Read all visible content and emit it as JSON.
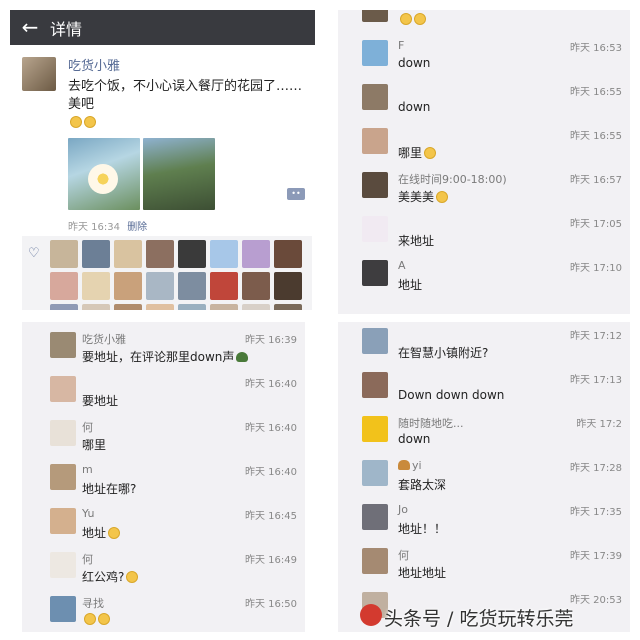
{
  "header": {
    "back_icon": "arrow-left-icon",
    "title": "详情"
  },
  "post": {
    "author": "吃货小雅",
    "text": "去吃个饭，不小心误入餐厅的花园了……美吧",
    "time": "昨天 16:34",
    "delete_label": "删除"
  },
  "comments_left": [
    {
      "name": "吃货小雅",
      "time": "昨天 16:39",
      "text": "要地址，在评论那里down声",
      "icon": "turtle",
      "avatar": "#9a8a73"
    },
    {
      "name": "",
      "time": "昨天 16:40",
      "text": "要地址",
      "avatar": "#d7b7a3"
    },
    {
      "name": "何",
      "time": "昨天 16:40",
      "text": "哪里",
      "avatar": "#e8e1d8"
    },
    {
      "name": "m",
      "time": "昨天 16:40",
      "text": "地址在哪?",
      "avatar": "#b59a7b"
    },
    {
      "name": "Yu",
      "time": "昨天 16:45",
      "text": "地址",
      "icon": "emoji",
      "avatar": "#d4b08e"
    },
    {
      "name": "何",
      "time": "昨天 16:49",
      "text": "红公鸡?",
      "icon": "emoji",
      "avatar": "#ede8e2"
    },
    {
      "name": "寻找",
      "time": "昨天 16:50",
      "text": "",
      "icon": "emoji2",
      "avatar": "#6d8fb0"
    }
  ],
  "comments_right_top": [
    {
      "name": "",
      "time": "",
      "text": "",
      "icon": "emoji2",
      "avatar": "#6b5b4a"
    },
    {
      "name": "F",
      "time": "昨天 16:53",
      "text": "down",
      "avatar": "#7eb0d8"
    },
    {
      "name": "",
      "time": "昨天 16:55",
      "text": "down",
      "avatar": "#8d7a66"
    },
    {
      "name": "",
      "time": "昨天 16:55",
      "text": "哪里",
      "icon": "emoji",
      "avatar": "#c9a48c"
    },
    {
      "name": "在线时间9:00-18:00)",
      "time": "昨天 16:57",
      "text": "美美美",
      "icon": "emoji",
      "avatar": "#5a4b3e"
    },
    {
      "name": "",
      "time": "昨天 17:05",
      "text": "来地址",
      "avatar": "#f1eaf2"
    },
    {
      "name": "A",
      "time": "昨天 17:10",
      "text": "地址",
      "avatar": "#3e3d3f"
    }
  ],
  "comments_right_bottom": [
    {
      "name": "",
      "time": "昨天 17:12",
      "text": "在智慧小镇附近?",
      "avatar": "#8aa0b8"
    },
    {
      "name": "",
      "time": "昨天 17:13",
      "text": "Down down down",
      "avatar": "#8b6a5a"
    },
    {
      "name": "随时随地吃...",
      "time": "昨天 17:2",
      "text": "down",
      "avatar": "#f2c21b"
    },
    {
      "name": "yi",
      "time": "昨天 17:28",
      "text": "套路太深",
      "icon": "burger",
      "avatar": "#9fb6c9"
    },
    {
      "name": "Jo",
      "time": "昨天 17:35",
      "text": "地址！！",
      "avatar": "#6f6f78"
    },
    {
      "name": "何",
      "time": "昨天 17:39",
      "text": "地址地址",
      "avatar": "#a58a72"
    },
    {
      "name": "",
      "time": "昨天 20:53",
      "text": "",
      "avatar": "#c0b0a0"
    }
  ],
  "watermark": "头条号 / 吃货玩转乐莞",
  "like_avatars": [
    "#c7b59a",
    "#6c7f96",
    "#d9c3a0",
    "#8c6f60",
    "#3a3a3a",
    "#a7c7e8",
    "#b89ed0",
    "#6a4a3a",
    "#d7a89c",
    "#e5d3b0",
    "#c9a17b",
    "#a9b7c5",
    "#7d8da0",
    "#c0463a",
    "#7c5c4c",
    "#4b3b2f",
    "#8f9ab5",
    "#d6c8b8",
    "#b08c6c",
    "#e0c0a0",
    "#9ab0c0",
    "#c8b4a0",
    "#d8d0c8",
    "#7a6a5a"
  ]
}
